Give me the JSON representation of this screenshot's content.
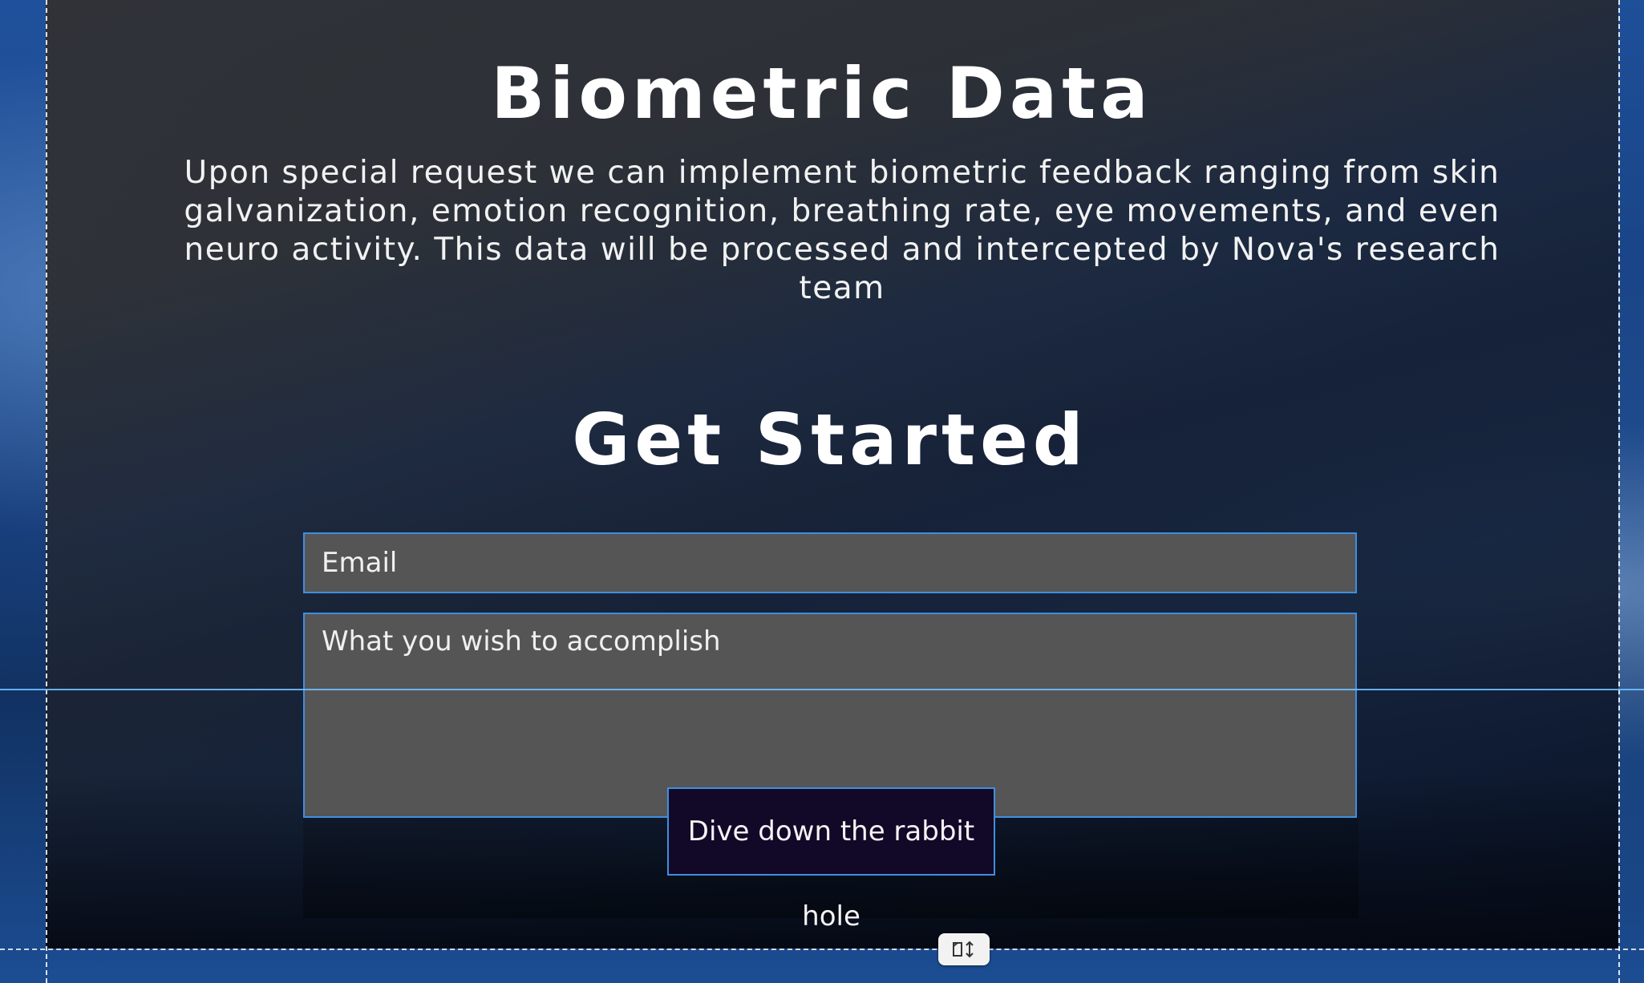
{
  "section": {
    "title": "Biometric Data",
    "body": "Upon special request we can implement biometric feedback ranging from skin galvanization, emotion recognition, breathing rate, eye movements, and even neuro activity.   This data will be processed and intercepted by Nova's research team"
  },
  "form": {
    "title": "Get Started",
    "email_placeholder": "Email",
    "message_placeholder": "What you wish to accomplish",
    "submit_label": "Dive down the rabbit hole"
  },
  "editor": {
    "resize_handle_icon": "resize-height-icon"
  }
}
